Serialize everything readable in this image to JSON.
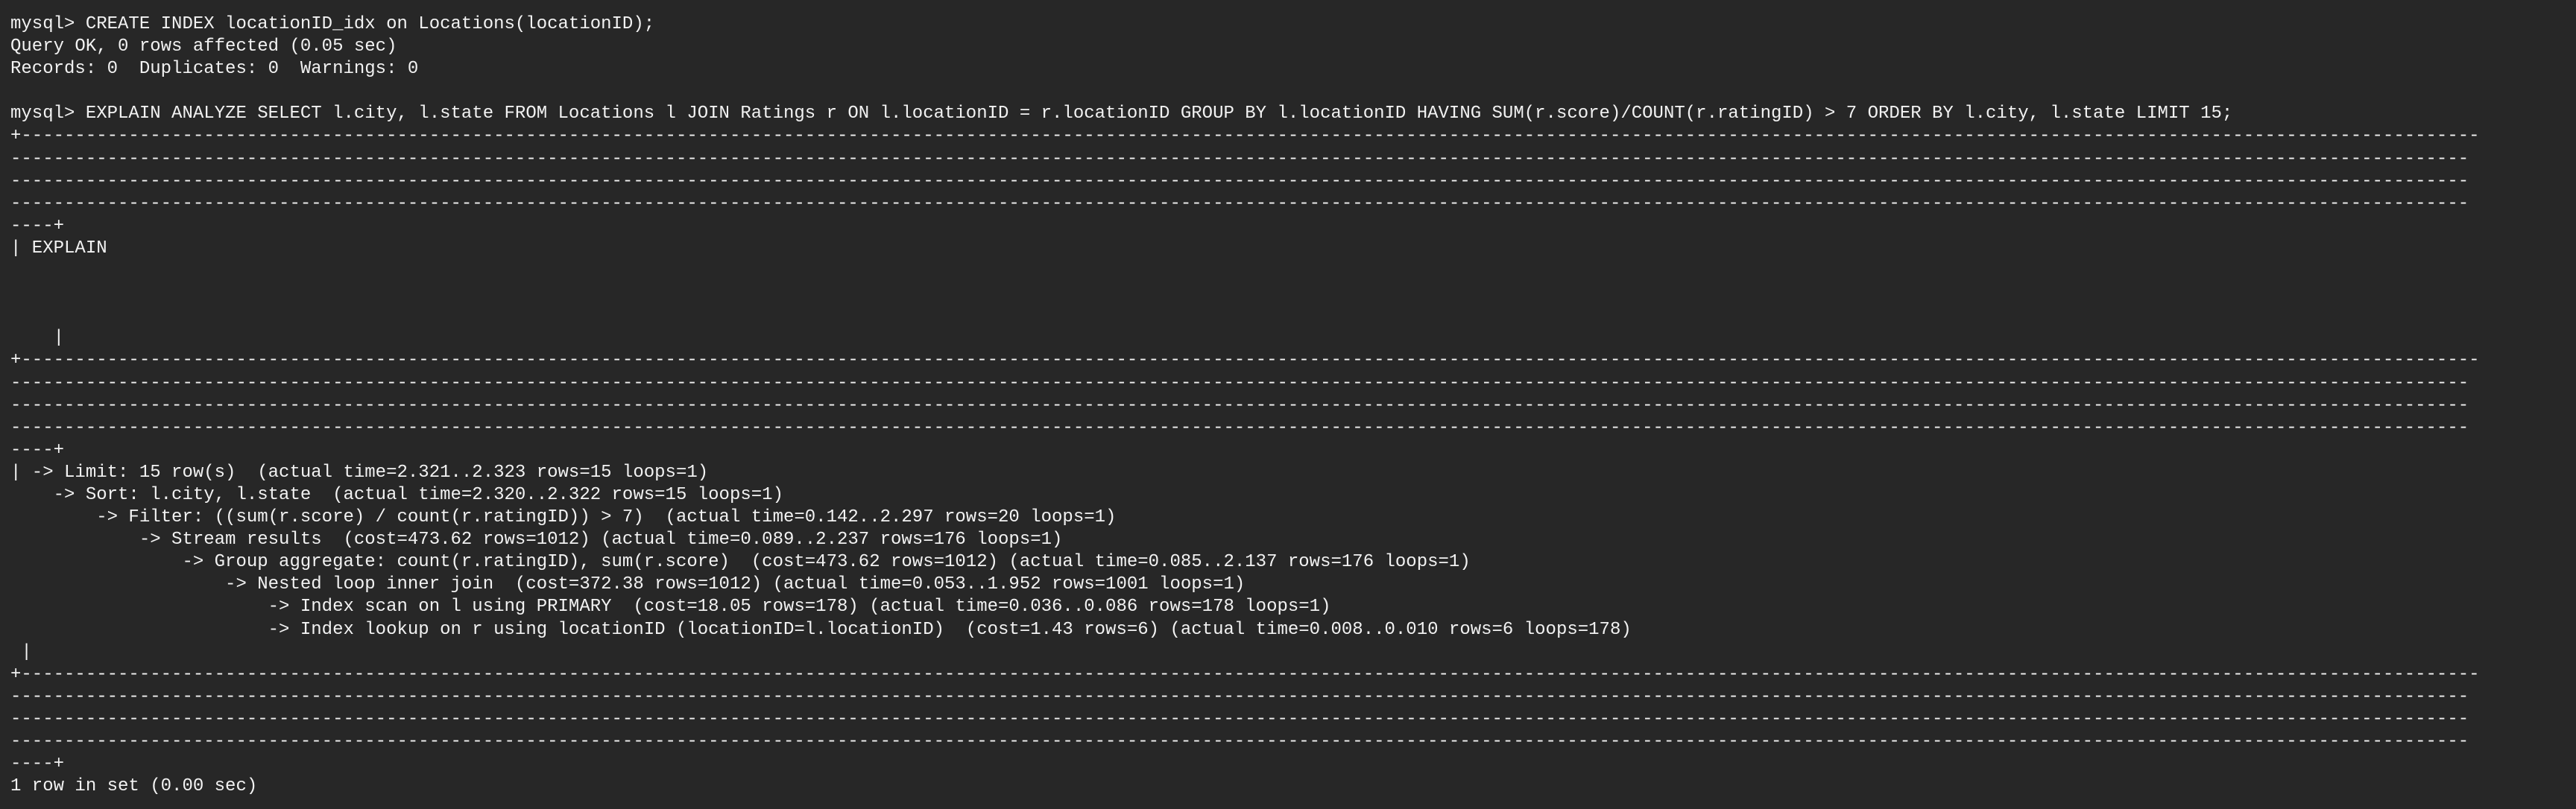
{
  "terminal": {
    "lines": [
      "mysql> CREATE INDEX locationID_idx on Locations(locationID);",
      "Query OK, 0 rows affected (0.05 sec)",
      "Records: 0  Duplicates: 0  Warnings: 0",
      "",
      "mysql> EXPLAIN ANALYZE SELECT l.city, l.state FROM Locations l JOIN Ratings r ON l.locationID = r.locationID GROUP BY l.locationID HAVING SUM(r.score)/COUNT(r.ratingID) > 7 ORDER BY l.city, l.state LIMIT 15;",
      "+-------------------------------------------------------------------------------------------------------------------------------------------------------------------------------------------------------------------------------------",
      "-------------------------------------------------------------------------------------------------------------------------------------------------------------------------------------------------------------------------------------",
      "-------------------------------------------------------------------------------------------------------------------------------------------------------------------------------------------------------------------------------------",
      "-------------------------------------------------------------------------------------------------------------------------------------------------------------------------------------------------------------------------------------",
      "----+",
      "| EXPLAIN",
      "",
      "",
      "",
      "    |",
      "+-------------------------------------------------------------------------------------------------------------------------------------------------------------------------------------------------------------------------------------",
      "-------------------------------------------------------------------------------------------------------------------------------------------------------------------------------------------------------------------------------------",
      "-------------------------------------------------------------------------------------------------------------------------------------------------------------------------------------------------------------------------------------",
      "-------------------------------------------------------------------------------------------------------------------------------------------------------------------------------------------------------------------------------------",
      "----+",
      "| -> Limit: 15 row(s)  (actual time=2.321..2.323 rows=15 loops=1)",
      "    -> Sort: l.city, l.state  (actual time=2.320..2.322 rows=15 loops=1)",
      "        -> Filter: ((sum(r.score) / count(r.ratingID)) > 7)  (actual time=0.142..2.297 rows=20 loops=1)",
      "            -> Stream results  (cost=473.62 rows=1012) (actual time=0.089..2.237 rows=176 loops=1)",
      "                -> Group aggregate: count(r.ratingID), sum(r.score)  (cost=473.62 rows=1012) (actual time=0.085..2.137 rows=176 loops=1)",
      "                    -> Nested loop inner join  (cost=372.38 rows=1012) (actual time=0.053..1.952 rows=1001 loops=1)",
      "                        -> Index scan on l using PRIMARY  (cost=18.05 rows=178) (actual time=0.036..0.086 rows=178 loops=1)",
      "                        -> Index lookup on r using locationID (locationID=l.locationID)  (cost=1.43 rows=6) (actual time=0.008..0.010 rows=6 loops=178)",
      " |",
      "+-------------------------------------------------------------------------------------------------------------------------------------------------------------------------------------------------------------------------------------",
      "-------------------------------------------------------------------------------------------------------------------------------------------------------------------------------------------------------------------------------------",
      "-------------------------------------------------------------------------------------------------------------------------------------------------------------------------------------------------------------------------------------",
      "-------------------------------------------------------------------------------------------------------------------------------------------------------------------------------------------------------------------------------------",
      "----+",
      "1 row in set (0.00 sec)"
    ]
  },
  "colors": {
    "background": "#272727",
    "text": "#f2f2f2"
  }
}
